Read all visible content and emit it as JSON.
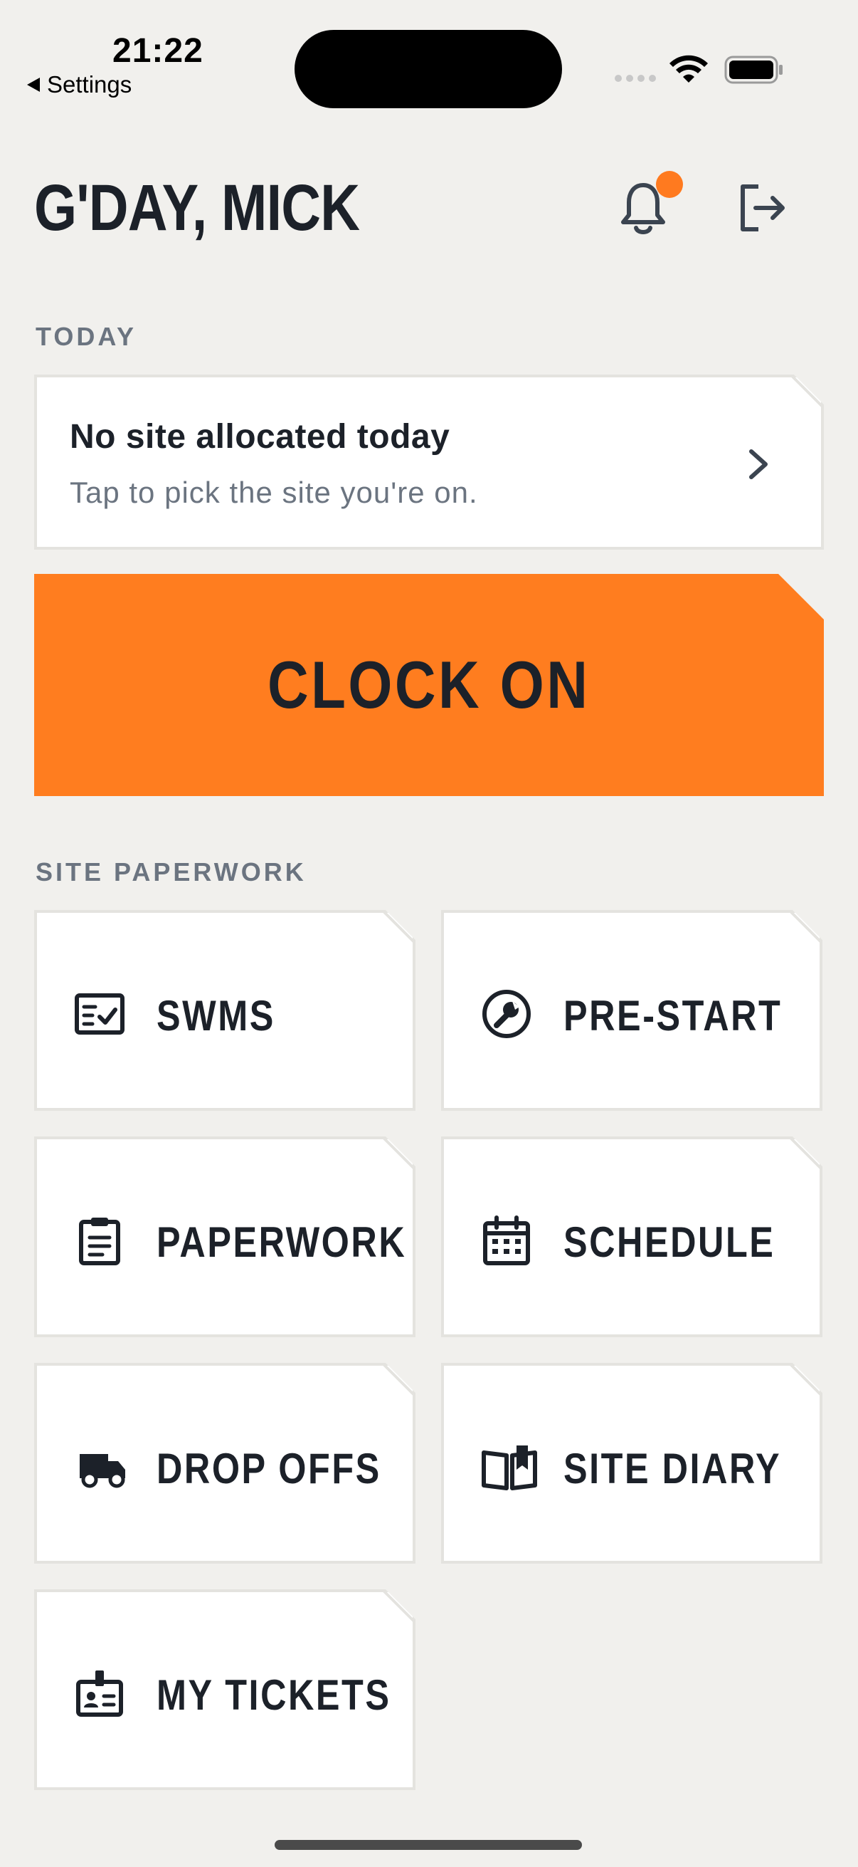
{
  "status_bar": {
    "time": "21:22",
    "back_label": "Settings"
  },
  "header": {
    "greeting": "G'DAY, MICK",
    "notification_dot_color": "#ff7a1f"
  },
  "today": {
    "section_label": "TODAY",
    "card_title": "No site allocated today",
    "card_subtitle": "Tap to pick the site you're on."
  },
  "clock_button": {
    "label": "CLOCK ON",
    "color": "#ff7d1f"
  },
  "paperwork": {
    "section_label": "SITE PAPERWORK",
    "tiles": [
      {
        "label": "SWMS",
        "icon": "checklist-icon"
      },
      {
        "label": "PRE-START",
        "icon": "wrench-icon"
      },
      {
        "label": "PAPERWORK",
        "icon": "clipboard-icon"
      },
      {
        "label": "SCHEDULE",
        "icon": "calendar-icon"
      },
      {
        "label": "DROP OFFS",
        "icon": "truck-icon"
      },
      {
        "label": "SITE DIARY",
        "icon": "open-book-icon"
      },
      {
        "label": "MY TICKETS",
        "icon": "id-badge-icon"
      }
    ]
  }
}
